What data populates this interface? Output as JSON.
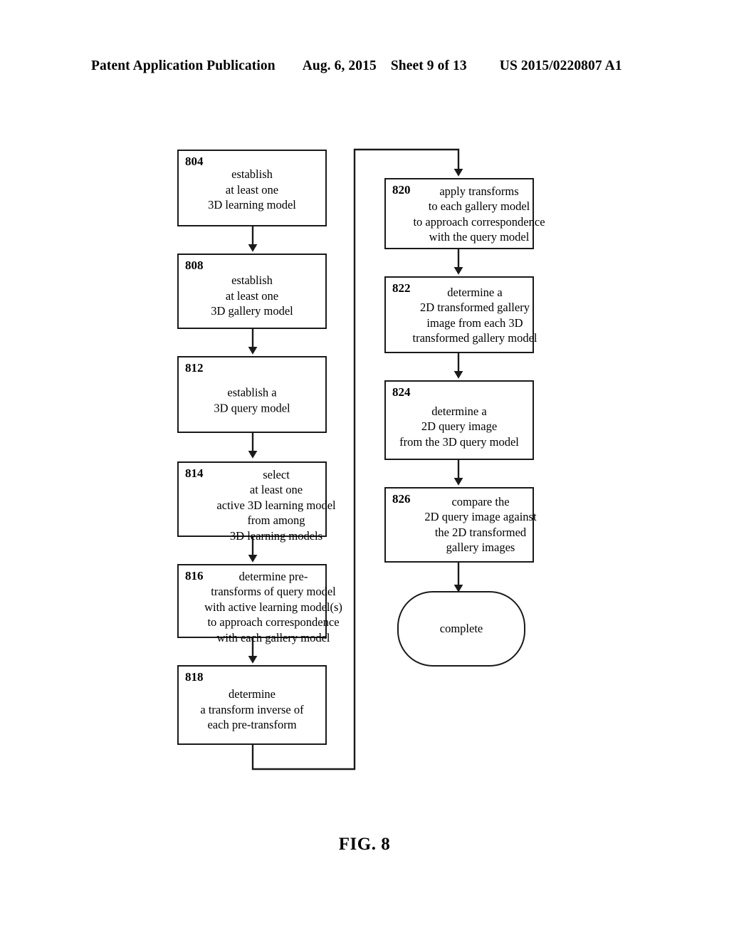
{
  "header": {
    "publication": "Patent Application Publication",
    "date": "Aug. 6, 2015",
    "sheet": "Sheet 9 of 13",
    "patent_number": "US 2015/0220807 A1"
  },
  "figure": {
    "caption": "FIG. 8"
  },
  "flowchart": {
    "nodes": [
      {
        "ref": "804",
        "text": "establish\nat least one\n3D learning model"
      },
      {
        "ref": "808",
        "text": "establish\nat least one\n3D gallery model"
      },
      {
        "ref": "812",
        "text": "establish a\n3D query model"
      },
      {
        "ref": "814",
        "text": "select\nat least one\nactive 3D learning model\nfrom among\n3D learning models"
      },
      {
        "ref": "816",
        "text": "determine pre-\ntransforms of query model\nwith active learning model(s)\nto approach correspondence\nwith each gallery model"
      },
      {
        "ref": "818",
        "text": "determine\na transform inverse of\neach pre-transform"
      },
      {
        "ref": "820",
        "text": "apply transforms\nto each gallery model\nto approach correspondence\nwith the query model"
      },
      {
        "ref": "822",
        "text": "determine a\n2D transformed gallery\nimage from each 3D\ntransformed gallery model"
      },
      {
        "ref": "824",
        "text": "determine a\n2D query image\nfrom the 3D query model"
      },
      {
        "ref": "826",
        "text": "compare the\n2D query image against\nthe 2D transformed\ngallery images"
      }
    ],
    "terminal": {
      "label": "complete"
    }
  }
}
